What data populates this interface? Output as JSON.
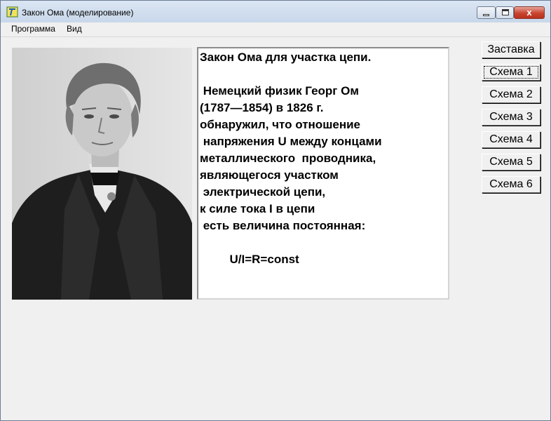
{
  "window": {
    "title": "Закон Ома (моделирование)",
    "close_glyph": "x"
  },
  "menu": {
    "items": [
      {
        "label": "Программа"
      },
      {
        "label": "Вид"
      }
    ]
  },
  "portrait": {
    "icon": "portrait-photo"
  },
  "text_panel": {
    "content": "Закон Ома для участка цепи.\n\n Немецкий физик Георг Ом\n(1787—1854) в 1826 г.\nобнаружил, что отношение\n напряжения U между концами\nметаллического  проводника,\nявляющегося участком\n электрической цепи,\nк силе тока I в цепи\n есть величина постоянная:\n\n         U/I=R=const"
  },
  "buttons": [
    {
      "label": "Заставка"
    },
    {
      "label": "Схема 1"
    },
    {
      "label": "Схема 2"
    },
    {
      "label": "Схема 3"
    },
    {
      "label": "Схема 4"
    },
    {
      "label": "Схема 5"
    },
    {
      "label": "Схема 6"
    }
  ],
  "active_button_index": 1
}
